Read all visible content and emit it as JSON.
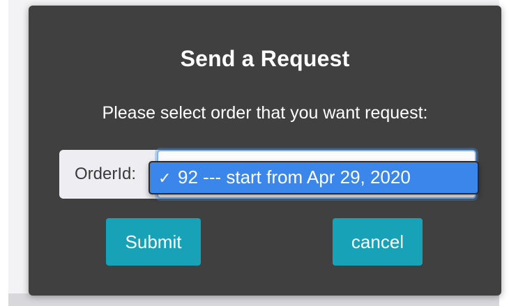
{
  "dialog": {
    "title": "Send a Request",
    "message": "Please select order that you want request:",
    "order_label": "OrderId:",
    "selected_option": {
      "check": "✓",
      "label": "92 --- start from Apr 29, 2020"
    },
    "submit_label": "Submit",
    "cancel_label": "cancel"
  },
  "colors": {
    "dialog_bg": "#404040",
    "button_bg": "#17a2b8",
    "selected_option_bg": "#3a86ea"
  },
  "icons": {
    "selected_marker": "check-icon"
  }
}
